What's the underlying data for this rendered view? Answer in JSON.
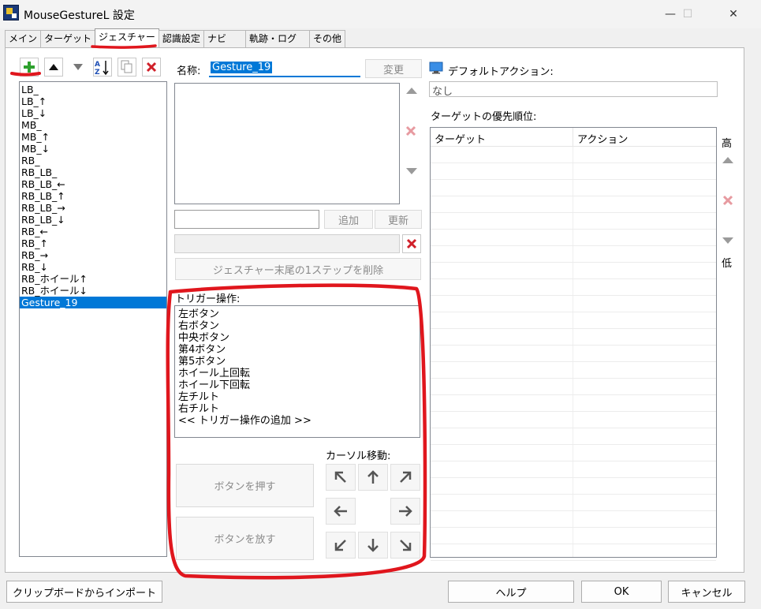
{
  "window": {
    "title": "MouseGestureL 設定",
    "minimize": "—",
    "maximize": "☐",
    "close": "✕"
  },
  "tabs": [
    {
      "label": "メイン"
    },
    {
      "label": "ターゲット"
    },
    {
      "label": "ジェスチャー"
    },
    {
      "label": "認識設定"
    },
    {
      "label": "ナビ"
    },
    {
      "label": "軌跡・ログ"
    },
    {
      "label": "その他"
    }
  ],
  "gesture_list": {
    "items": [
      "LB_",
      "LB_↑",
      "LB_↓",
      "MB_",
      "MB_↑",
      "MB_↓",
      "RB_",
      "RB_LB_",
      "RB_LB_←",
      "RB_LB_↑",
      "RB_LB_→",
      "RB_LB_↓",
      "RB_←",
      "RB_↑",
      "RB_→",
      "RB_↓",
      "RB_ホイール↑",
      "RB_ホイール↓",
      "Gesture_19"
    ],
    "selected": "Gesture_19"
  },
  "editor": {
    "name_label": "名称:",
    "name_value": "Gesture_19",
    "change_button": "変更",
    "add_button": "追加",
    "update_button": "更新",
    "delete_last_step": "ジェスチャー末尾の1ステップを削除",
    "trigger_label": "トリガー操作:",
    "trigger_items": [
      "左ボタン",
      "右ボタン",
      "中央ボタン",
      "第4ボタン",
      "第5ボタン",
      "ホイール上回転",
      "ホイール下回転",
      "左チルト",
      "右チルト",
      "<< トリガー操作の追加 >>"
    ],
    "press_button": "ボタンを押す",
    "release_button": "ボタンを放す",
    "cursor_label": "カーソル移動:"
  },
  "default_action": {
    "label": "デフォルトアクション:",
    "value": "なし"
  },
  "priority": {
    "label": "ターゲットの優先順位:",
    "columns": [
      "ターゲット",
      "アクション"
    ],
    "high": "高",
    "low": "低"
  },
  "footer": {
    "import_button": "クリップボードからインポート",
    "help_button": "ヘルプ",
    "ok_button": "OK",
    "cancel_button": "キャンセル"
  },
  "colors": {
    "selection": "#0078d7",
    "annotation": "#e0161d",
    "add_icon": "#2ea02e",
    "delete_icon": "#d0202a"
  }
}
